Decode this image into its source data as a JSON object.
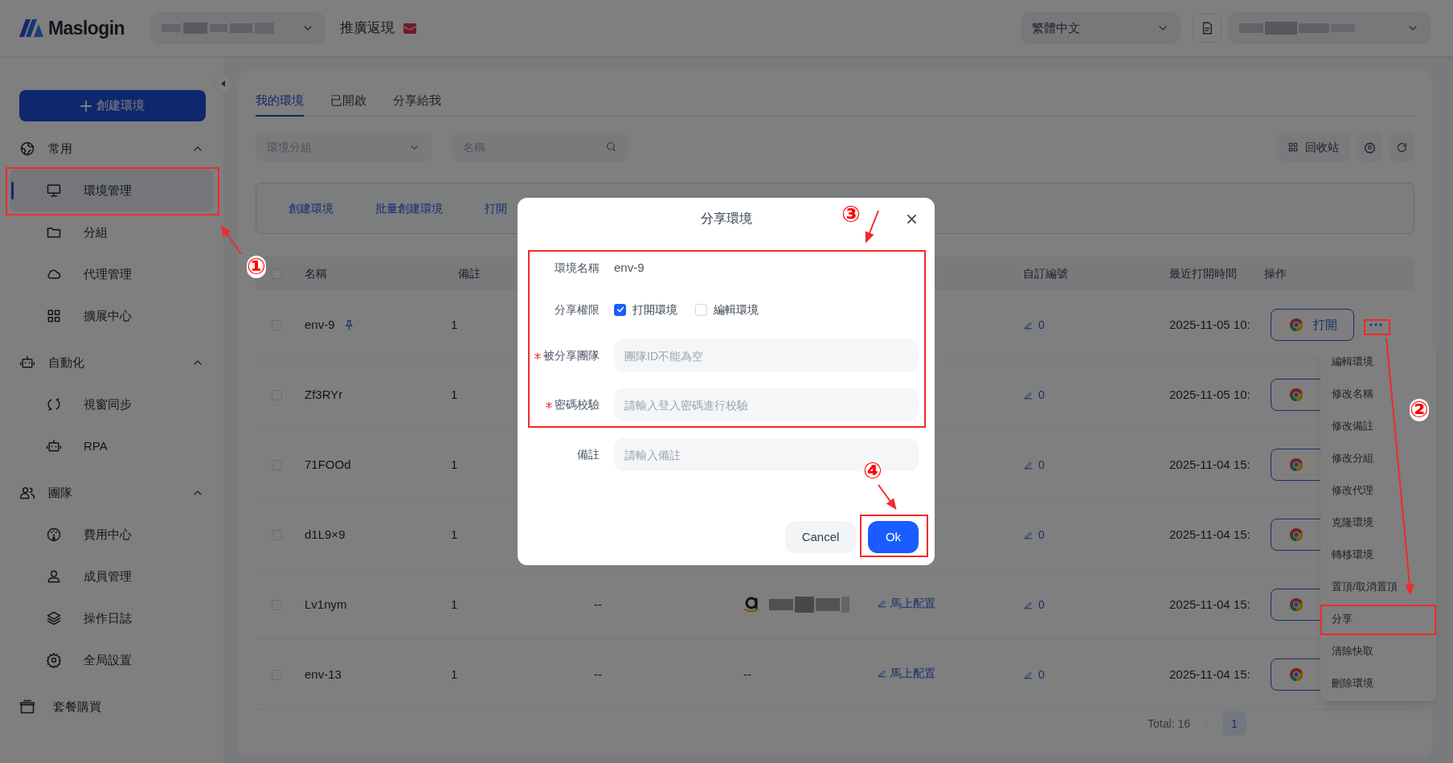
{
  "header": {
    "logo": "Maslogin",
    "promo": "推廣返現",
    "language": "繁體中文"
  },
  "sidebar": {
    "create_button": "創建環境",
    "sections": [
      {
        "kind": "group",
        "label": "常用",
        "expanded": true,
        "children": [
          {
            "label": "環境管理",
            "selected": true
          },
          {
            "label": "分組",
            "selected": false
          },
          {
            "label": "代理管理",
            "selected": false
          },
          {
            "label": "擴展中心",
            "selected": false
          }
        ]
      },
      {
        "kind": "group",
        "label": "自動化",
        "expanded": true,
        "children": [
          {
            "label": "視窗同步",
            "selected": false
          },
          {
            "label": "RPA",
            "selected": false
          }
        ]
      },
      {
        "kind": "group",
        "label": "團隊",
        "expanded": true,
        "children": [
          {
            "label": "費用中心",
            "selected": false
          },
          {
            "label": "成員管理",
            "selected": false
          },
          {
            "label": "操作日誌",
            "selected": false
          },
          {
            "label": "全局設置",
            "selected": false
          }
        ]
      },
      {
        "kind": "link",
        "label": "套餐購買"
      }
    ]
  },
  "tabs": [
    {
      "label": "我的環境",
      "selected": true
    },
    {
      "label": "已開啟",
      "selected": false
    },
    {
      "label": "分享給我",
      "selected": false
    }
  ],
  "filters": {
    "group_placeholder": "環境分組",
    "search_placeholder": "名稱",
    "recycle_button": "回收站"
  },
  "actions": [
    "創建環境",
    "批量創建環境",
    "打開"
  ],
  "table": {
    "header_checked": false,
    "columns": [
      "名稱",
      "備註",
      "自訂編號",
      "最近打開時間",
      "操作"
    ],
    "rows": [
      {
        "checked": false,
        "name": "env-9",
        "pinned": true,
        "note": "1",
        "custom_id": "0",
        "last_opened": "2025-11-05 10:",
        "open_label": "打開",
        "more_button": true
      },
      {
        "checked": false,
        "name": "Zf3RYr",
        "pinned": false,
        "note": "1",
        "custom_id": "0",
        "last_opened": "2025-11-05 10:"
      },
      {
        "checked": false,
        "name": "71FOOd",
        "pinned": false,
        "note": "1",
        "custom_id": "0",
        "last_opened": "2025-11-04 15:"
      },
      {
        "checked": false,
        "name": "d1L9×9",
        "pinned": false,
        "note": "1",
        "custom_id": "0",
        "last_opened": "2025-11-04 15:"
      },
      {
        "checked": false,
        "name": "Lv1nym",
        "pinned": false,
        "note": "1",
        "column_3": "--",
        "column_4": {
          "kind": "platform"
        },
        "column_5": "馬上配置",
        "custom_id": "0",
        "last_opened": "2025-11-04 15:"
      },
      {
        "checked": false,
        "name": "env-13",
        "pinned": false,
        "note": "1",
        "column_3": "--",
        "column_4": {
          "kind": "text",
          "text": "--"
        },
        "column_5": "馬上配置",
        "custom_id": "0",
        "last_opened": "2025-11-04 15:"
      }
    ]
  },
  "menu": [
    "編輯環境",
    "修改名稱",
    "修改備註",
    "修改分組",
    "修改代理",
    "克隆環境",
    "轉移環境",
    "置頂/取消置頂",
    "分享",
    "清除快取",
    "刪除環境"
  ],
  "pagination": {
    "total": "Total: 16",
    "pages": [
      {
        "label": "1",
        "selected": true
      }
    ]
  },
  "modal": {
    "title": "分享環境",
    "fields": [
      {
        "kind": "text",
        "label": "環境名稱",
        "value": "env-9"
      },
      {
        "kind": "checkboxes",
        "label": "分享權限",
        "options": [
          {
            "label": "打開環境",
            "checked": true
          },
          {
            "label": "編輯環境",
            "checked": false
          }
        ]
      },
      {
        "kind": "input",
        "label": "被分享團隊",
        "required": true,
        "placeholder": "團隊ID不能為空"
      },
      {
        "kind": "input",
        "label": "密碼校驗",
        "required": true,
        "placeholder": "請輸入登入密碼進行校驗"
      },
      {
        "kind": "input",
        "label": "備註",
        "required": false,
        "placeholder": "請輸入備註"
      }
    ],
    "buttons": [
      {
        "kind": "secondary",
        "label": "Cancel"
      },
      {
        "kind": "primary",
        "label": "Ok"
      }
    ]
  },
  "annotations": [
    {
      "kind": "box"
    },
    {
      "kind": "arrow"
    },
    {
      "kind": "step",
      "text": "①"
    },
    {
      "kind": "box"
    },
    {
      "kind": "arrow"
    },
    {
      "kind": "step",
      "text": "②"
    },
    {
      "kind": "box"
    },
    {
      "kind": "box"
    },
    {
      "kind": "arrow"
    },
    {
      "kind": "step",
      "text": "③"
    },
    {
      "kind": "box"
    },
    {
      "kind": "arrow"
    },
    {
      "kind": "step",
      "text": "④"
    }
  ]
}
